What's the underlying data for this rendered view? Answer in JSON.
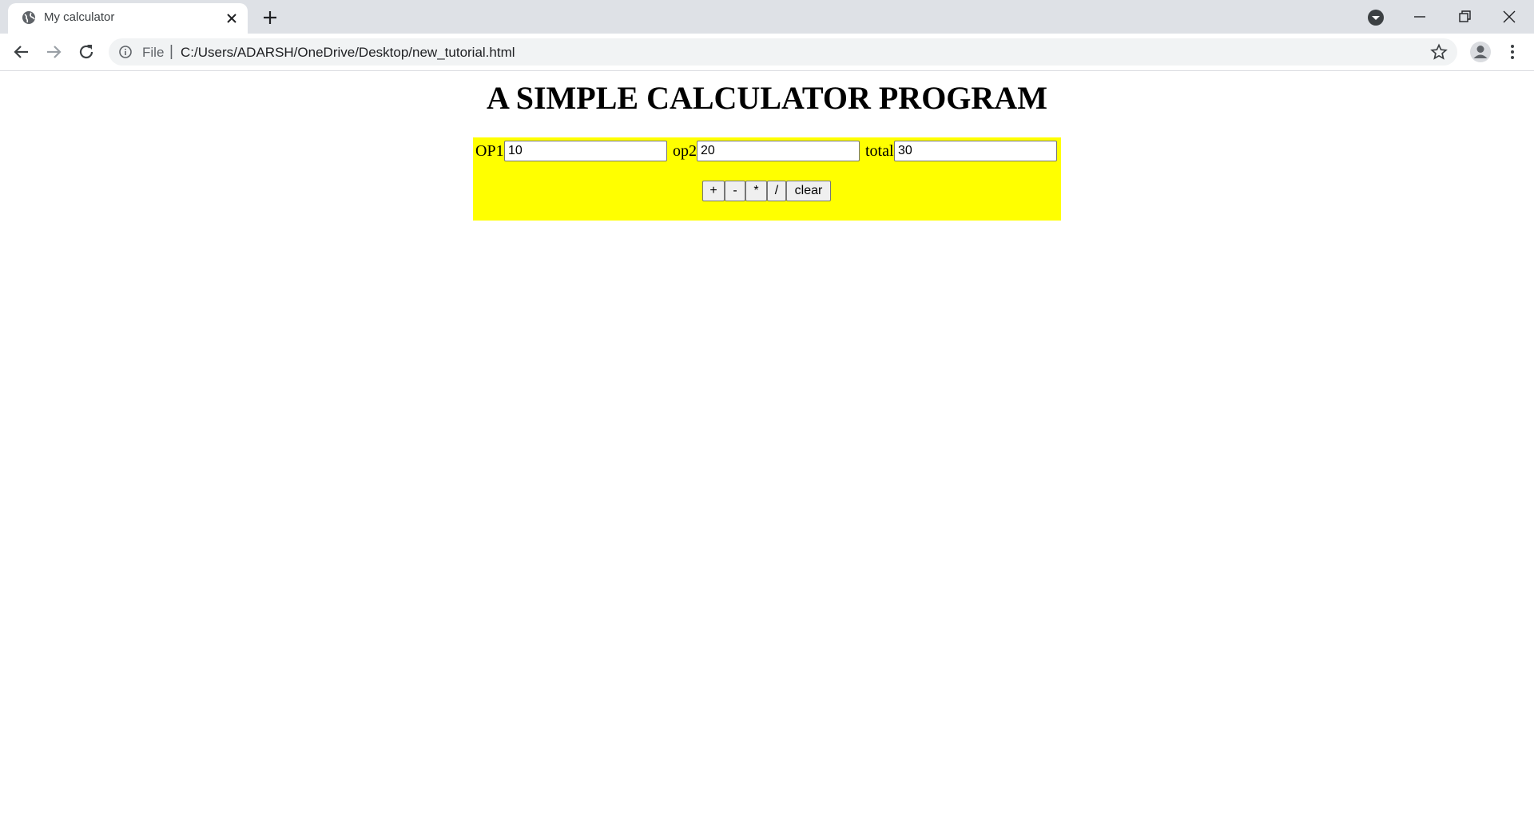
{
  "browser": {
    "tab_title": "My calculator",
    "omnibox": {
      "scheme_label": "File",
      "separator": "|",
      "url": "C:/Users/ADARSH/OneDrive/Desktop/new_tutorial.html"
    }
  },
  "page": {
    "heading": "A SIMPLE CALCULATOR PROGRAM",
    "background_color": "#ffff00",
    "fields": {
      "op1": {
        "label": "OP1",
        "value": "10"
      },
      "op2": {
        "label": "op2",
        "value": "20"
      },
      "total": {
        "label": "total",
        "value": "30"
      }
    },
    "buttons": {
      "add": "+",
      "subtract": "-",
      "multiply": "*",
      "divide": "/",
      "clear": "clear"
    }
  }
}
